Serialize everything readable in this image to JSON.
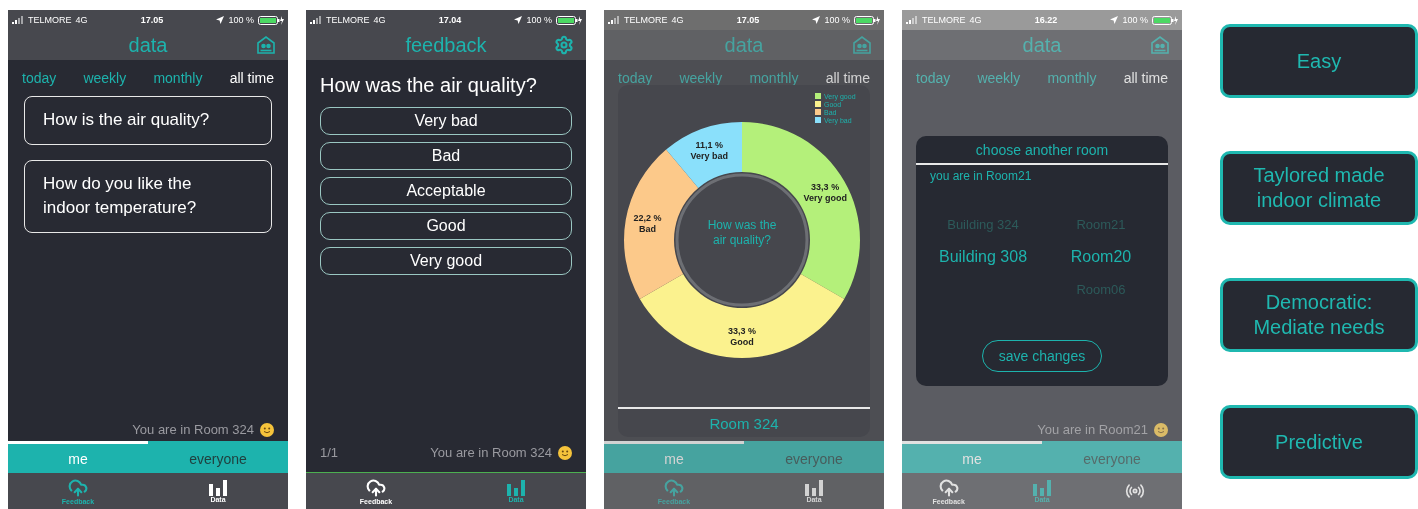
{
  "phones": [
    {
      "kind": "data",
      "dimmed": false,
      "status": {
        "carrier": "TELMORE",
        "network": "4G",
        "time": "17.05",
        "battery": "100 %"
      },
      "title": "data",
      "periods": [
        {
          "label": "today",
          "selected": false
        },
        {
          "label": "weekly",
          "selected": false
        },
        {
          "label": "monthly",
          "selected": false
        },
        {
          "label": "all time",
          "selected": true
        }
      ],
      "questions": [
        "How is the air quality?",
        "How do you like the indoor temperature?"
      ],
      "location": "You are in Room 324",
      "audience": [
        {
          "label": "me",
          "selected": true
        },
        {
          "label": "everyone",
          "selected": false
        }
      ],
      "nav": [
        {
          "kind": "cloud",
          "label": "Feedback",
          "selected": true
        },
        {
          "kind": "bars",
          "label": "Data",
          "selected": false
        }
      ]
    },
    {
      "kind": "feedback",
      "dimmed": false,
      "status": {
        "carrier": "TELMORE",
        "network": "4G",
        "time": "17.04",
        "battery": "100 %"
      },
      "title": "feedback",
      "question": "How was the air quality?",
      "options": [
        "Very bad",
        "Bad",
        "Acceptable",
        "Good",
        "Very good"
      ],
      "page": "1/1",
      "location": "You are in Room 324",
      "nav": [
        {
          "kind": "cloud",
          "label": "Feedback",
          "selected": false
        },
        {
          "kind": "bars",
          "label": "Data",
          "selected": true
        }
      ]
    },
    {
      "kind": "data",
      "dimmed": true,
      "status": {
        "carrier": "TELMORE",
        "network": "4G",
        "time": "17.05",
        "battery": "100 %"
      },
      "title": "data",
      "periods": [
        {
          "label": "today",
          "selected": false
        },
        {
          "label": "weekly",
          "selected": false
        },
        {
          "label": "monthly",
          "selected": false
        },
        {
          "label": "all time",
          "selected": true
        }
      ],
      "audience": [
        {
          "label": "me",
          "selected": true
        },
        {
          "label": "everyone",
          "selected": false
        }
      ],
      "nav": [
        {
          "kind": "cloud",
          "label": "Feedback",
          "selected": true
        },
        {
          "kind": "bars",
          "label": "Data",
          "selected": false
        }
      ],
      "modal": {
        "kind": "chart",
        "center_text": "How was the air quality?",
        "footer": "Room 324",
        "chart_data": {
          "type": "donut",
          "categories": [
            "Very good",
            "Good",
            "Bad",
            "Very bad"
          ],
          "values": [
            33.3,
            33.3,
            22.2,
            11.1
          ],
          "legend": true,
          "colors": [
            "#b4f07a",
            "#fbf28e",
            "#fcc98a",
            "#8ae0fb"
          ],
          "value_labels": [
            "33,3 %",
            "33,3 %",
            "22,2 %",
            "11,1 %"
          ]
        }
      }
    },
    {
      "kind": "data",
      "dimmed": true,
      "status": {
        "carrier": "TELMORE",
        "network": "4G",
        "time": "16.22",
        "battery": "100 %"
      },
      "title": "data",
      "periods": [
        {
          "label": "today",
          "selected": false
        },
        {
          "label": "weekly",
          "selected": false
        },
        {
          "label": "monthly",
          "selected": false
        },
        {
          "label": "all time",
          "selected": true
        }
      ],
      "location": "You are in Room21",
      "audience": [
        {
          "label": "me",
          "selected": true
        },
        {
          "label": "everyone",
          "selected": false
        }
      ],
      "nav": [
        {
          "kind": "cloud",
          "label": "Feedback",
          "selected": false
        },
        {
          "kind": "bars",
          "label": "Data",
          "selected": true
        },
        {
          "kind": "broadcast",
          "selected": false
        }
      ],
      "modal": {
        "kind": "rooms",
        "title": "choose another room",
        "current": "you are in Room21",
        "buildings": [
          {
            "label": "Building 324",
            "selected": false
          },
          {
            "label": "Building 308",
            "selected": true
          }
        ],
        "rooms": [
          {
            "label": "Room21",
            "selected": false
          },
          {
            "label": "Room20",
            "selected": true
          },
          {
            "label": "Room06",
            "selected": false
          }
        ],
        "button": "save changes"
      }
    }
  ],
  "labels": [
    "Easy",
    "Taylored made indoor climate",
    "Democratic: Mediate needs",
    "Predictive"
  ]
}
